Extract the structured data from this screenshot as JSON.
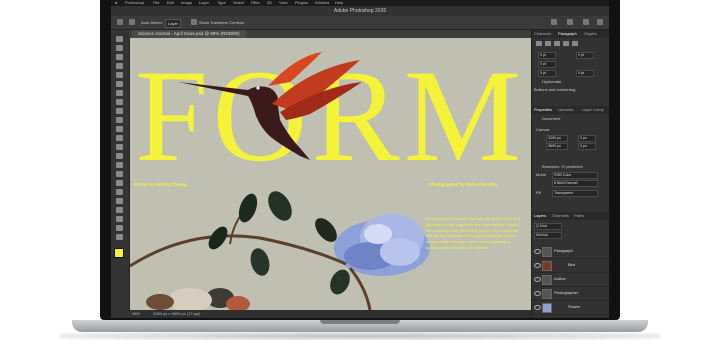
{
  "app": {
    "menu": [
      "Photoshop",
      "File",
      "Edit",
      "Image",
      "Layer",
      "Type",
      "Select",
      "Filter",
      "3D",
      "View",
      "Plugins",
      "Window",
      "Help"
    ],
    "window_title": "Adobe Photoshop 2026"
  },
  "options_bar": {
    "auto_select_label": "Auto-Select:",
    "auto_select_value": "Layer",
    "transform_label": "Show Transform Controls"
  },
  "document": {
    "tab_title": "Science Journal - April Issue.psd @ 98% (RGB/8#)",
    "headline": "FORM",
    "byline_left": "Written by Melody Cheung",
    "byline_right": "Photographed by Richard Bentley",
    "body_copy": "In this edition of Science Journal, we explore form as it appears in living organisms: the hummingbird in flight, the unfolding petal, the curling tendril. The shapes we see are not accidents of beauty but solutions refined across millions of years, each curve answering a question posed by light, air and time."
  },
  "status_bar": {
    "zoom": "98%",
    "doc_size": "3390 px x 9690 px (72 ppi)"
  },
  "right_panel": {
    "top_tabs": [
      "Character",
      "Paragraph",
      "Glyphs"
    ],
    "active_top_tab": "Paragraph",
    "para_values": [
      "0 pt",
      "0 pt",
      "0 pt",
      "0 pt",
      "0 pt"
    ],
    "hyphenate_label": "Hyphenate",
    "buttons_label": "Buttons and numbering",
    "mid_tabs": [
      "Properties",
      "Libraries",
      "Layer Comp"
    ],
    "document_label": "Document",
    "canvas_label": "Canvas",
    "canvas_w": "3390 px",
    "canvas_h": "9690 px",
    "canvas_x": "0 px",
    "canvas_y": "0 px",
    "resolution": "Resolution: 72 pixels/inch",
    "mode_label": "Mode",
    "mode_value": "RGB Color",
    "bitdepth_value": "8 Bits/Channel",
    "fill_label": "Fill",
    "fill_value": "Transparent",
    "layers_tabs": [
      "Layers",
      "Channels",
      "Paths"
    ],
    "layer_kind": "Q Kind",
    "layer_mode": "Normal",
    "layers": [
      "Paragraph",
      "Bird",
      "Author",
      "Photographer",
      "Flower"
    ]
  },
  "colors": {
    "headline": "#f5f23a",
    "canvas_bg": "#bfc0b2",
    "ui_dark": "#323232"
  }
}
